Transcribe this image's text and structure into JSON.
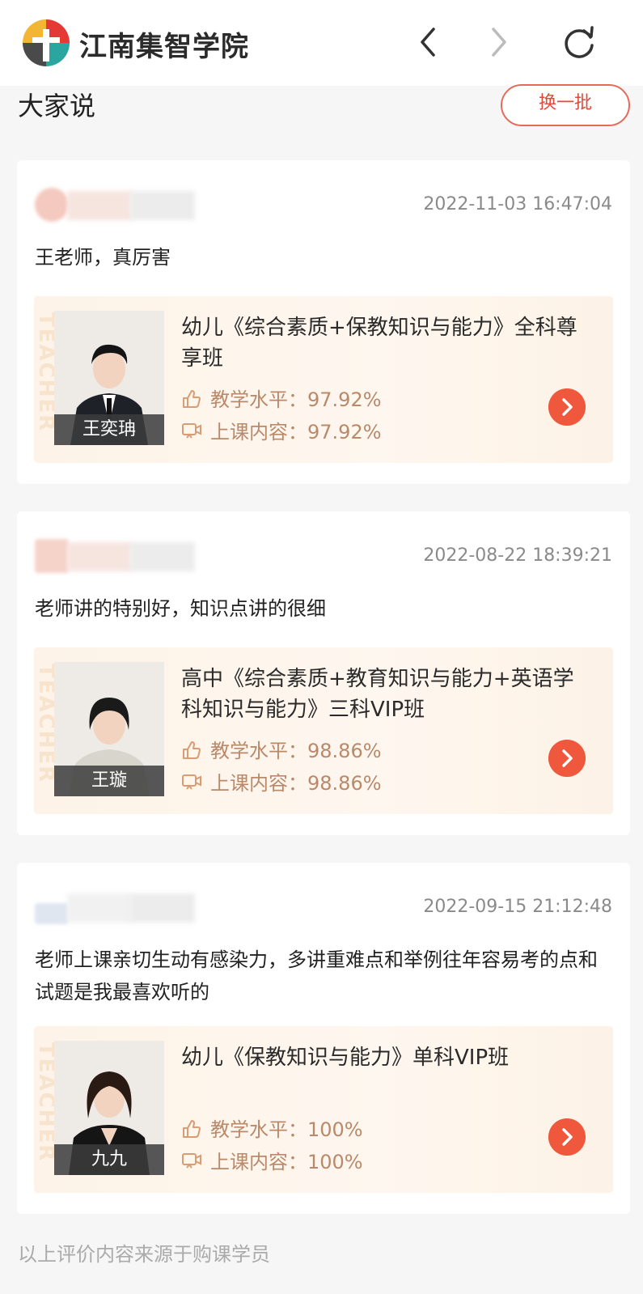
{
  "header": {
    "brand_name": "江南集智学院"
  },
  "section": {
    "title": "大家说",
    "refresh_label": "换一批"
  },
  "reviews": [
    {
      "time": "2022-11-03 16:47:04",
      "comment": "王老师，真厉害",
      "course_title": "幼儿《综合素质+保教知识与能力》全科尊享班",
      "teacher_name": "王奕珃",
      "teaching_label": "教学水平：",
      "teaching_value": "97.92%",
      "content_label": "上课内容：",
      "content_value": "97.92%"
    },
    {
      "time": "2022-08-22 18:39:21",
      "comment": "老师讲的特别好，知识点讲的很细",
      "course_title": "高中《综合素质+教育知识与能力+英语学科知识与能力》三科VIP班",
      "teacher_name": "王璇",
      "teaching_label": "教学水平：",
      "teaching_value": "98.86%",
      "content_label": "上课内容：",
      "content_value": "98.86%"
    },
    {
      "time": "2022-09-15 21:12:48",
      "comment": "老师上课亲切生动有感染力，多讲重难点和举例往年容易考的点和试题是我最喜欢听的",
      "course_title": "幼儿《保教知识与能力》单科VIP班",
      "teacher_name": "九九",
      "teaching_label": "教学水平：",
      "teaching_value": "100%",
      "content_label": "上课内容：",
      "content_value": "100%"
    }
  ],
  "watermark": "TEACHER",
  "footer": {
    "note": "以上评价内容来源于购课学员"
  }
}
